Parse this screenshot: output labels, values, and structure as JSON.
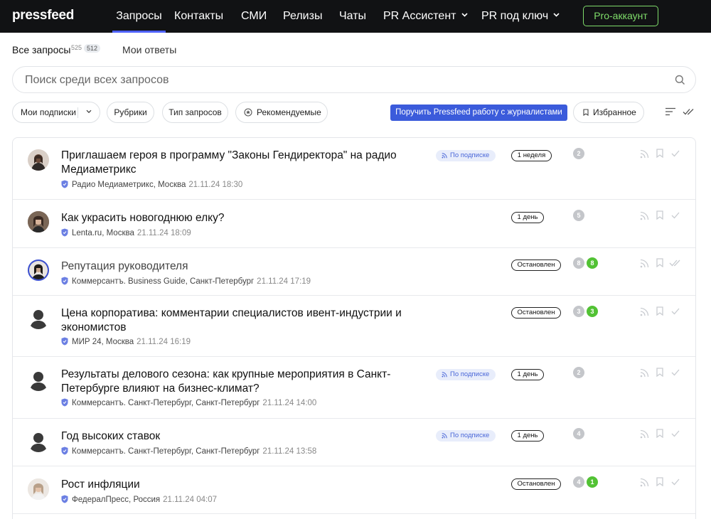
{
  "nav": {
    "logo": "pressfeed",
    "items": [
      {
        "label": "Запросы",
        "active": true
      },
      {
        "label": "Контакты"
      },
      {
        "label": "СМИ"
      },
      {
        "label": "Релизы"
      },
      {
        "label": "Чаты"
      },
      {
        "label": "PR Ассистент",
        "dropdown": true
      },
      {
        "label": "PR под ключ",
        "dropdown": true
      }
    ],
    "pro_button": "Pro-аккаунт"
  },
  "tabs": {
    "all_label": "Все запросы",
    "all_count": "525",
    "all_count_new": "512",
    "mine_label": "Мои ответы"
  },
  "search": {
    "placeholder": "Поиск среди всех запросов",
    "value": ""
  },
  "filters": {
    "subscriptions": "Мои подписки",
    "rubrics": "Рубрики",
    "request_type": "Тип запросов",
    "recommended": "Рекомендуемые",
    "cta": "Поручить Pressfeed работу с журналистами",
    "favorites": "Избранное"
  },
  "colors": {
    "accent": "#3b5bdb",
    "pro": "#7fdc6a",
    "green_badge": "#52c234",
    "nav_bg": "#111214"
  },
  "requests": [
    {
      "title": "Приглашаем героя в программу \"Законы Гендиректора\" на радио Медиаметрикс",
      "source": "Радио Медиаметрикс, Москва",
      "date": "21.11.24 18:30",
      "subscription": "По подписке",
      "status": "1 неделя",
      "grey_count": "2",
      "green_count": "",
      "read": false
    },
    {
      "title": "Как украсить новогоднюю елку?",
      "source": "Lenta.ru, Москва",
      "date": "21.11.24 18:09",
      "subscription": "",
      "status": "1 день",
      "grey_count": "5",
      "green_count": "",
      "read": false
    },
    {
      "title": "Репутация руководителя",
      "source": "Коммерсантъ. Business Guide, Санкт-Петербург",
      "date": "21.11.24 17:19",
      "subscription": "",
      "status": "Остановлен",
      "grey_count": "8",
      "green_count": "8",
      "read": true
    },
    {
      "title": "Цена корпоратива: комментарии специалистов ивент-индустрии и экономистов",
      "source": "МИР 24, Москва",
      "date": "21.11.24 16:19",
      "subscription": "",
      "status": "Остановлен",
      "grey_count": "3",
      "green_count": "3",
      "read": false
    },
    {
      "title": "Результаты делового сезона: как крупные мероприятия в Санкт-Петербурге влияют на бизнес-климат?",
      "source": "Коммерсантъ. Санкт-Петербург, Санкт-Петербург",
      "date": "21.11.24 14:00",
      "subscription": "По подписке",
      "status": "1 день",
      "grey_count": "2",
      "green_count": "",
      "read": false
    },
    {
      "title": "Год высоких ставок",
      "source": "Коммерсантъ. Санкт-Петербург, Санкт-Петербург",
      "date": "21.11.24 13:58",
      "subscription": "По подписке",
      "status": "1 день",
      "grey_count": "4",
      "green_count": "",
      "read": false
    },
    {
      "title": "Рост инфляции",
      "source": "ФедералПресс, Россия",
      "date": "21.11.24 04:07",
      "subscription": "",
      "status": "Остановлен",
      "grey_count": "4",
      "green_count": "1",
      "read": false
    }
  ]
}
